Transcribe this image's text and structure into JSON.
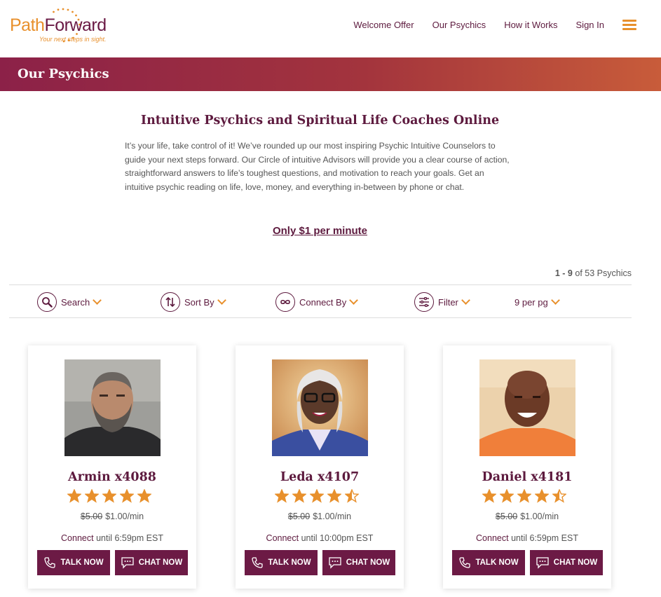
{
  "brand": {
    "name_part1": "Path",
    "name_part2": "Forward",
    "tagline": "Your next steps in sight.",
    "accent_color": "#e8902c",
    "primary_color": "#5d1a3e"
  },
  "nav": {
    "items": [
      "Welcome Offer",
      "Our Psychics",
      "How it Works",
      "Sign In"
    ],
    "menu_icon": "hamburger-menu-icon"
  },
  "banner": {
    "title": "Our Psychics"
  },
  "intro": {
    "title": "Intuitive Psychics and Spiritual Life Coaches Online",
    "body": "It’s your life, take control of it! We’ve rounded up our most inspiring Psychic Intuitive Counselors to guide your next steps forward. Our Circle of intuitive Advisors will provide you a clear course of action, straightforward answers to life’s toughest questions, and motivation to reach your goals. Get an intuitive psychic reading on life, love, money, and everything in-between by phone or chat.",
    "price_link": "Only $1 per minute"
  },
  "results": {
    "range": "1 - 9",
    "of": "of",
    "total": "53 Psychics"
  },
  "toolbar": {
    "search": "Search",
    "sort": "Sort By",
    "connect": "Connect By",
    "filter": "Filter",
    "per_page": "9 per pg"
  },
  "psychics": [
    {
      "name": "Armin x4088",
      "rating": 5,
      "old_price": "$5.00",
      "price": "$1.00/min",
      "connect": "Connect",
      "until": "until 6:59pm EST",
      "talk": "TALK NOW",
      "chat": "CHAT NOW"
    },
    {
      "name": "Leda x4107",
      "rating": 4.5,
      "old_price": "$5.00",
      "price": "$1.00/min",
      "connect": "Connect",
      "until": "until 10:00pm EST",
      "talk": "TALK NOW",
      "chat": "CHAT NOW"
    },
    {
      "name": "Daniel x4181",
      "rating": 4.5,
      "old_price": "$5.00",
      "price": "$1.00/min",
      "connect": "Connect",
      "until": "until 6:59pm EST",
      "talk": "TALK NOW",
      "chat": "CHAT NOW"
    }
  ]
}
